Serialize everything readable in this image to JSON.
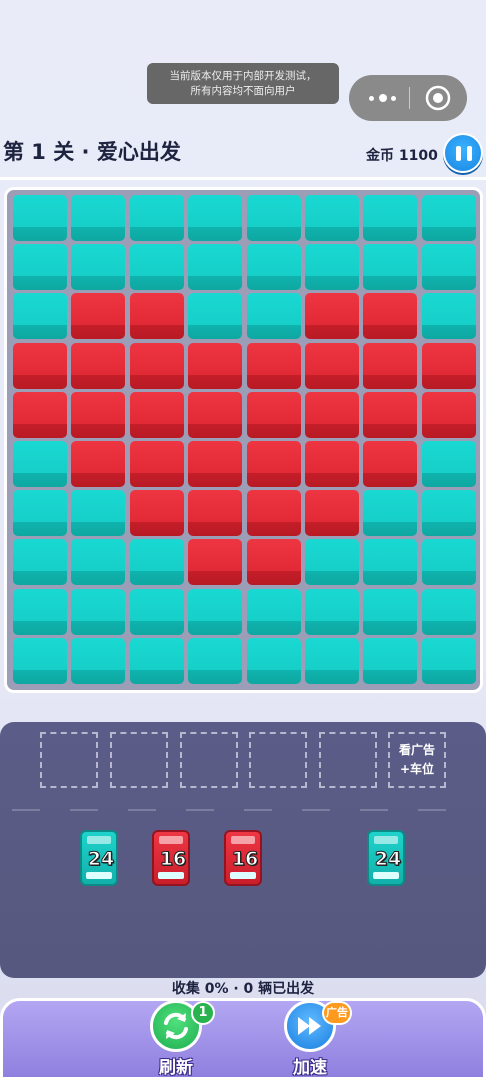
{
  "notice": {
    "line1": "当前版本仅用于内部开发测试，",
    "line2": "所有内容均不面向用户"
  },
  "capsule": {
    "more_icon": "more-dots-icon",
    "close_icon": "target-icon"
  },
  "header": {
    "title": "第 1 关 · 爱心出发",
    "coins": "金币 1100",
    "pause_icon": "pause-icon"
  },
  "board": {
    "rows": [
      "cccccccc",
      "cccccccc",
      "crrccrrc",
      "rrrrrrrr",
      "rrrrrrrr",
      "crrrrrrc",
      "ccrrrrcc",
      "cccrrccc",
      "cccccccc",
      "cccccccc"
    ],
    "colors": {
      "c": "#16cfc8",
      "r": "#e22a36"
    }
  },
  "dock": {
    "ad_slot_line1": "看广告",
    "ad_slot_line2": "+车位",
    "cars": [
      {
        "color": "cyan",
        "number": "24"
      },
      {
        "color": "red",
        "number": "16"
      },
      {
        "color": "red",
        "number": "16"
      },
      {
        "color": "cyan",
        "number": "24"
      }
    ]
  },
  "status": "收集 0% · 0 辆已出发",
  "buttons": {
    "refresh_label": "刷新",
    "refresh_badge": "1",
    "refresh_icon": "refresh-icon",
    "speed_label": "加速",
    "speed_badge": "广告",
    "speed_icon": "fast-forward-icon"
  }
}
